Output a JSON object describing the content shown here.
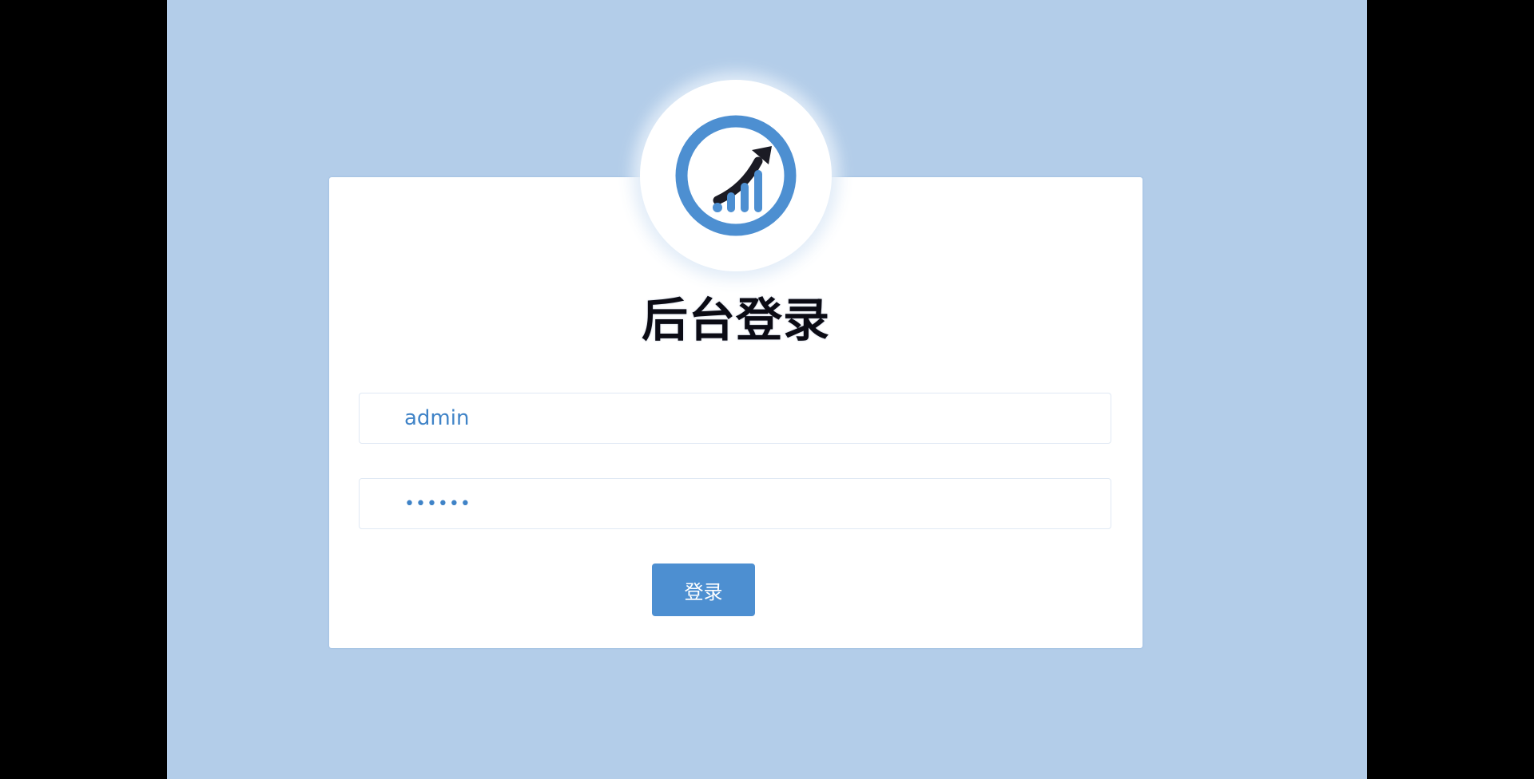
{
  "login": {
    "title": "后台登录",
    "username_value": "admin",
    "password_value": "******",
    "submit_label": "登录"
  },
  "logo": {
    "icon": "growth-chart-icon"
  },
  "colors": {
    "background": "#b3cde9",
    "accent": "#4d8fd1",
    "input_text": "#3f83c7",
    "title_text": "#0b0b14",
    "card": "#ffffff"
  }
}
